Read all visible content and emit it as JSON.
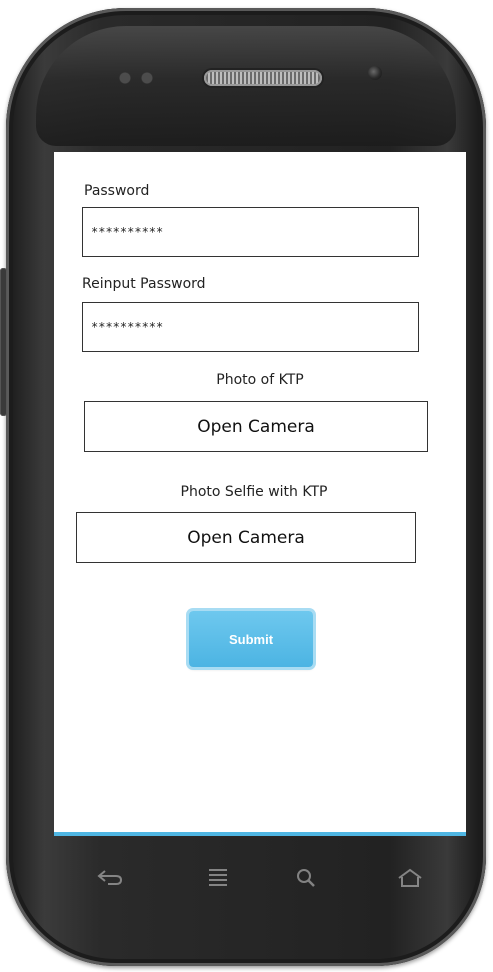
{
  "form": {
    "password_label": "Password",
    "password_value": "**********",
    "reinput_label": "Reinput Password",
    "reinput_value": "**********",
    "ktp_photo_label": "Photo of KTP",
    "ktp_camera_button": "Open Camera",
    "selfie_label": "Photo Selfie with KTP",
    "selfie_camera_button": "Open Camera",
    "submit_label": "Submit"
  },
  "nav": {
    "icons": [
      "back-icon",
      "menu-icon",
      "search-icon",
      "home-icon"
    ]
  },
  "colors": {
    "accent": "#4fb6e3",
    "phone_body": "#2a2a2a"
  }
}
